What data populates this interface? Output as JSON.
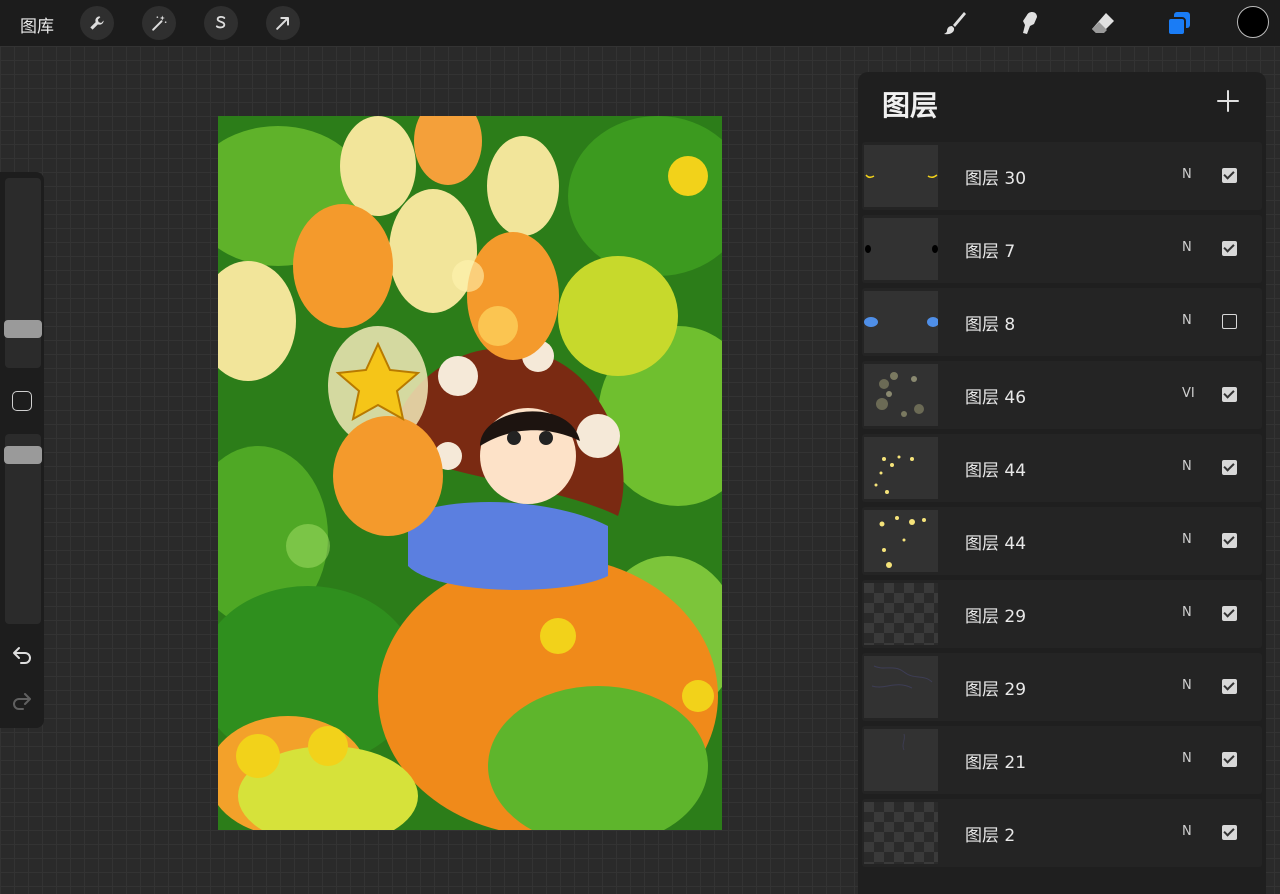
{
  "topbar": {
    "gallery_label": "图库",
    "tools_left": [
      "wrench-icon",
      "magic-wand-icon",
      "selection-s-icon",
      "arrow-transform-icon"
    ],
    "tools_right": [
      "brush-icon",
      "smudge-icon",
      "eraser-icon",
      "layers-icon"
    ],
    "active_tool": "layers-icon",
    "accent_color": "#1a7cf5",
    "current_color": "#000000"
  },
  "sidebar": {
    "brush_size_label": "brush-size-slider",
    "opacity_label": "opacity-slider"
  },
  "layers_panel": {
    "title": "图层",
    "add_icon": "plus-icon",
    "layers": [
      {
        "name": "图层 30",
        "blend": "N",
        "visible": true
      },
      {
        "name": "图层 7",
        "blend": "N",
        "visible": true
      },
      {
        "name": "图层 8",
        "blend": "N",
        "visible": false
      },
      {
        "name": "图层 46",
        "blend": "VI",
        "visible": true
      },
      {
        "name": "图层 44",
        "blend": "N",
        "visible": true
      },
      {
        "name": "图层 44",
        "blend": "N",
        "visible": true
      },
      {
        "name": "图层 29",
        "blend": "N",
        "visible": true
      },
      {
        "name": "图层 29",
        "blend": "N",
        "visible": true
      },
      {
        "name": "图层 21",
        "blend": "N",
        "visible": true
      },
      {
        "name": "图层 2",
        "blend": "N",
        "visible": true
      }
    ]
  }
}
